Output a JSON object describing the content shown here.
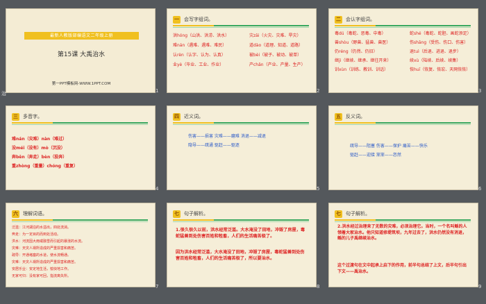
{
  "slides": [
    {
      "n": "1",
      "title_bar": "最新人教版部编语文二年级上册",
      "lesson": "第15课  大禹治水",
      "footer": "第一PPT模板网-WWW.1PPT.COM"
    },
    {
      "n": "2",
      "tag": "一",
      "heading": "会写字组词。",
      "rows": [
        [
          "洪hóng（山洪、洪涝、洪水）",
          "灾zāi（火灾、灾难、旱灾）"
        ],
        [
          "难nán（遇难、遇难、难民）",
          "道dào（道理、知道、道路）"
        ],
        [
          "认rèn（认字、认为、认真）",
          "被bèi（被子、被动、被单）"
        ],
        [
          "业yè（毕业、工业、作业）",
          "产chǎn（产业、产量、生产）"
        ]
      ]
    },
    {
      "n": "3",
      "tag": "二",
      "heading": "会认字组词。",
      "rows": [
        [
          "毒dú（毒蛇、恶毒、中毒）",
          "蛇shé（毒蛇、蛇胆、画蛇添足）"
        ],
        [
          "兽shòu（野兽、猛兽、兽医）",
          "伤shāng（受伤、伤口、伤害）"
        ],
        [
          "仍réng（仍然、仍旧）",
          "退tuì（后退、进退、退步）"
        ],
        [
          "继jì（继续、继承、继往开来）",
          "续xù（陆续、后续、续集）"
        ],
        [
          "训xùn（训练、教训、训话）",
          "恢huī（恢复、恢宏、天网恢恢）"
        ]
      ]
    },
    {
      "n": "4",
      "tag": "三",
      "heading": "多音字。",
      "rows": [
        "难nán（灾难）nàn（难过）",
        "没méi（没有）mò（沉没）",
        "奔bēn（奔走）bèn（投奔）",
        "重zhòng（重量）chóng（重复）"
      ]
    },
    {
      "n": "5",
      "tag": "四",
      "heading": "近义词。",
      "rows": [
        "伤害——损害  灾难——磨难  消退——减退",
        "隐导——疏通  驱赶——驱逐"
      ]
    },
    {
      "n": "6",
      "tag": "五",
      "heading": "反义词。",
      "rows": [
        "疏导——阻塞  伤害——保护  痛苦——快乐",
        "驱赶——迎接  渐渐——忽然"
      ]
    },
    {
      "n": "7",
      "tag": "六",
      "heading": "理解词语。",
      "rows": [
        "泛滥：江河湖泊的水溢出，四处流淌。",
        "奔走：为一定目的而到处活动。",
        "洪水：河流因大雨或融雪而引起的暴涨的水流。",
        "灾难：天灾人祸所造成的严重损害和痛苦。",
        "疏导：开通堵塞的水道，使水流畅通。",
        "灾难：天灾人祸所造成的严重损害和痛苦。",
        "安居乐业：安定地生活，愉快地工作。",
        "无家可归：没有家可回，指流离失所。"
      ]
    },
    {
      "n": "8",
      "tag": "七",
      "heading": "句子解析。",
      "paras": [
        "1.很久很久以前，洪水经常泛滥。大水淹没了田地，冲毁了房屋，毒蛇猛兽到处伤害百姓和牲畜，人们的生活痛苦极了。",
        "因为洪水经常泛滥，大水淹没了田地，冲毁了房屋，毒蛇猛兽到处伤害百姓和牲畜，人们的生活痛苦极了，所以要治水。"
      ]
    },
    {
      "n": "9",
      "tag": "七",
      "heading": "句子解析。",
      "paras": [
        "2.洪水经过治理来了无数的灾难，必须治理它。当时，一个名叫鲧的人领着大家治水。他只知道修堤筑坝，九年过去了，洪水仍然没有消退，鲧的儿子禹继续治水。",
        "这个过渡句在文中起承上启下的作用，前半句总结了上文，后半句引出下文——禹治水。"
      ]
    }
  ],
  "toolbar_text": "治"
}
